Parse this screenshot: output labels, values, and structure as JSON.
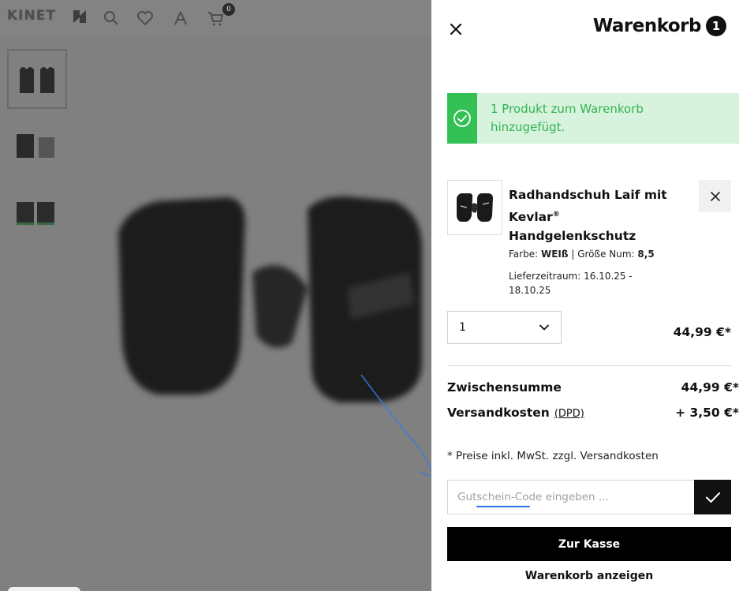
{
  "background": {
    "logo": "KINET",
    "cart_badge_count": "0"
  },
  "drawer": {
    "title": "Warenkorb",
    "item_count": "1",
    "alert_message": "1 Produkt zum Warenkorb hinzugefügt.",
    "product": {
      "name_part1": "Radhandschuh Laif mit Kevlar",
      "registered_mark": "®",
      "name_part2": "Handgelenkschutz",
      "color_label": "Farbe:",
      "color_value": "WEIß",
      "separator": "|",
      "size_label": "Größe Num:",
      "size_value": "8,5",
      "delivery": "Lieferzeitraum: 16.10.25 - 18.10.25",
      "quantity": "1",
      "price": "44,99 €*"
    },
    "subtotal_label": "Zwischensumme",
    "subtotal_value": "44,99 €*",
    "shipping_label": "Versandkosten",
    "shipping_carrier": "(DPD)",
    "shipping_value": "+ 3,50 €*",
    "tax_note": "* Preise inkl. MwSt. zzgl. Versandkosten",
    "coupon_placeholder": "Gutschein-Code eingeben ...",
    "checkout_label": "Zur Kasse",
    "view_cart_label": "Warenkorb anzeigen"
  },
  "icons": {
    "close": "close-icon",
    "check_circle": "check-circle-icon",
    "remove": "close-icon",
    "dropdown": "chevron-down-icon",
    "coupon_submit": "checkmark-icon"
  },
  "colors": {
    "success_bg": "#d8f3dd",
    "success_accent": "#33c054",
    "primary": "#000000",
    "overlay": "#808080",
    "annotation": "#2e74e6"
  }
}
